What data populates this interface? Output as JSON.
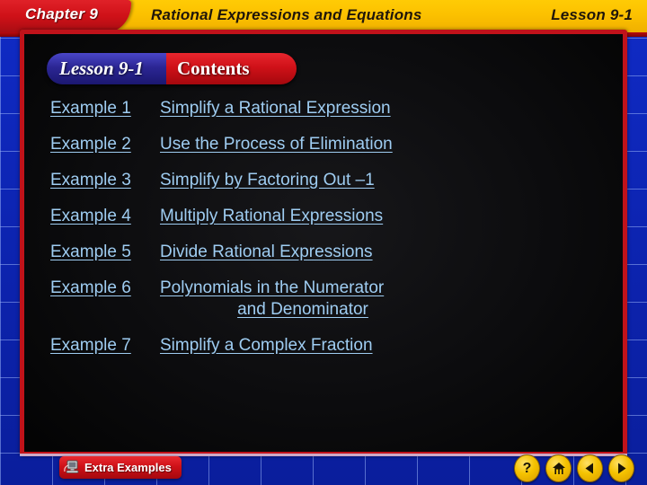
{
  "topbar": {
    "chapter": "Chapter 9",
    "title": "Rational Expressions and Equations",
    "lesson": "Lesson 9-1"
  },
  "contents_banner": {
    "lesson_label": "Lesson 9-1",
    "contents_label": "Contents"
  },
  "examples": [
    {
      "num": "Example 1",
      "desc": "Simplify a Rational Expression",
      "desc2": ""
    },
    {
      "num": "Example 2",
      "desc": "Use the Process of Elimination",
      "desc2": ""
    },
    {
      "num": "Example 3",
      "desc": "Simplify by Factoring Out –1",
      "desc2": ""
    },
    {
      "num": "Example 4",
      "desc": "Multiply Rational Expressions",
      "desc2": ""
    },
    {
      "num": "Example 5",
      "desc": "Divide Rational Expressions",
      "desc2": ""
    },
    {
      "num": "Example 6",
      "desc": "Polynomials in the Numerator",
      "desc2": "and Denominator"
    },
    {
      "num": "Example 7",
      "desc": "Simplify a Complex Fraction",
      "desc2": ""
    }
  ],
  "bottom": {
    "extra_examples_label": "Extra Examples",
    "extra_examples_icon": "computer-monitor-icon",
    "nav": [
      {
        "name": "help-button",
        "icon": "question-mark-icon",
        "glyph": "?"
      },
      {
        "name": "home-button",
        "icon": "house-icon",
        "glyph": ""
      },
      {
        "name": "previous-button",
        "icon": "left-arrow-icon",
        "glyph": ""
      },
      {
        "name": "next-button",
        "icon": "right-arrow-icon",
        "glyph": ""
      }
    ]
  },
  "colors": {
    "banner_yellow": "#fcc100",
    "banner_red": "#cf1118",
    "frame_blue": "#0c23ae",
    "link_blue": "#9fcdf2",
    "nav_yellow": "#f5c200",
    "stage_black": "#0c0c0e"
  }
}
